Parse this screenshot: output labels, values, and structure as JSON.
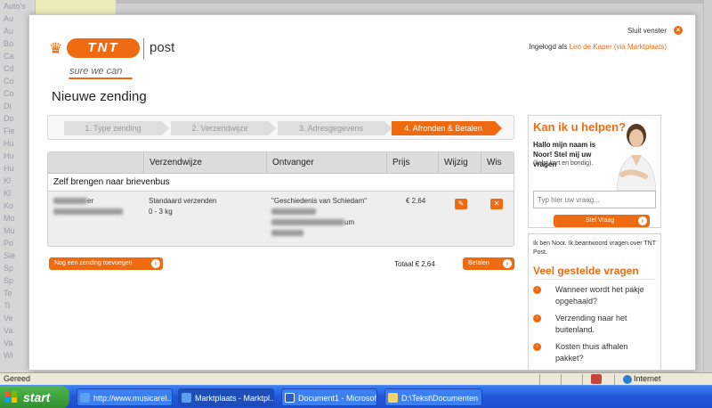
{
  "background_page": {
    "sidebar_labels": [
      "Auto's",
      "Au",
      "Au",
      "Bo",
      "Ca",
      "Cd",
      "Co",
      "Co",
      "Di",
      "Do",
      "Fie",
      "Hu",
      "Hu",
      "Hu",
      "Kl",
      "Kl",
      "Ko",
      "Mo",
      "Mu",
      "Po",
      "Sie",
      "Sp",
      "Sp",
      "Te",
      "Ti",
      "Ve",
      "Va",
      "Va",
      "Wi"
    ]
  },
  "header": {
    "logo_text": "TNT",
    "logo_post": "post",
    "slogan": "sure we can",
    "close_label": "Sluit venster",
    "login_prefix": "Ingelogd als",
    "login_user": "Leo de Kaper (via Marktplaats)"
  },
  "page_title": "Nieuwe zending",
  "steps": [
    {
      "label": "1. Type zending",
      "active": false
    },
    {
      "label": "2. Verzendwijze",
      "active": false
    },
    {
      "label": "3. Adresgegevens",
      "active": false
    },
    {
      "label": "4. Afronden & Betalen",
      "active": true
    }
  ],
  "table": {
    "headers": [
      "Verzendwijze",
      "Ontvanger",
      "Prijs",
      "Wijzig",
      "Wis"
    ],
    "section_title": "Zelf brengen naar brievenbus",
    "row": {
      "sender_suffix": "er",
      "method_line1": "Standaard verzenden",
      "method_line2": "0 - 3 kg",
      "recipient_line1": "\"Geschiedenis van Schiedam\"",
      "recipient_line3_suffix": "um",
      "price": "€ 2,64"
    }
  },
  "actions": {
    "add_label": "Nog een zending toevoegen",
    "total_label": "Totaal € 2,64",
    "pay_label": "Betalen"
  },
  "help": {
    "title": "Kan ik u helpen?",
    "intro": "Hallo mijn naam is Noor! Stel mij uw vragen",
    "sub": "(liefst kort en bondig).",
    "placeholder": "Typ hier uw vraag...",
    "ask_label": "Stel Vraag"
  },
  "faq": {
    "intro": "Ik ben Noor. Ik beantwoord vragen over TNT Post.",
    "title": "Veel gestelde vragen",
    "items": [
      "Wanneer wordt het pakje opgehaald?",
      "Verzending naar het buitenland.",
      "Kosten thuis afhalen pakket?"
    ]
  },
  "statusbar": {
    "status": "Gereed",
    "zone": "Internet"
  },
  "taskbar": {
    "start": "start",
    "tasks": [
      "http://www.musicarel...",
      "Marktplaats - Marktpl...",
      "Document1 - Microsof...",
      "D:\\Tekst\\Documenten"
    ]
  },
  "colors": {
    "accent": "#ef6b12",
    "taskbar": "#2157d7",
    "start": "#3a9a3a"
  }
}
